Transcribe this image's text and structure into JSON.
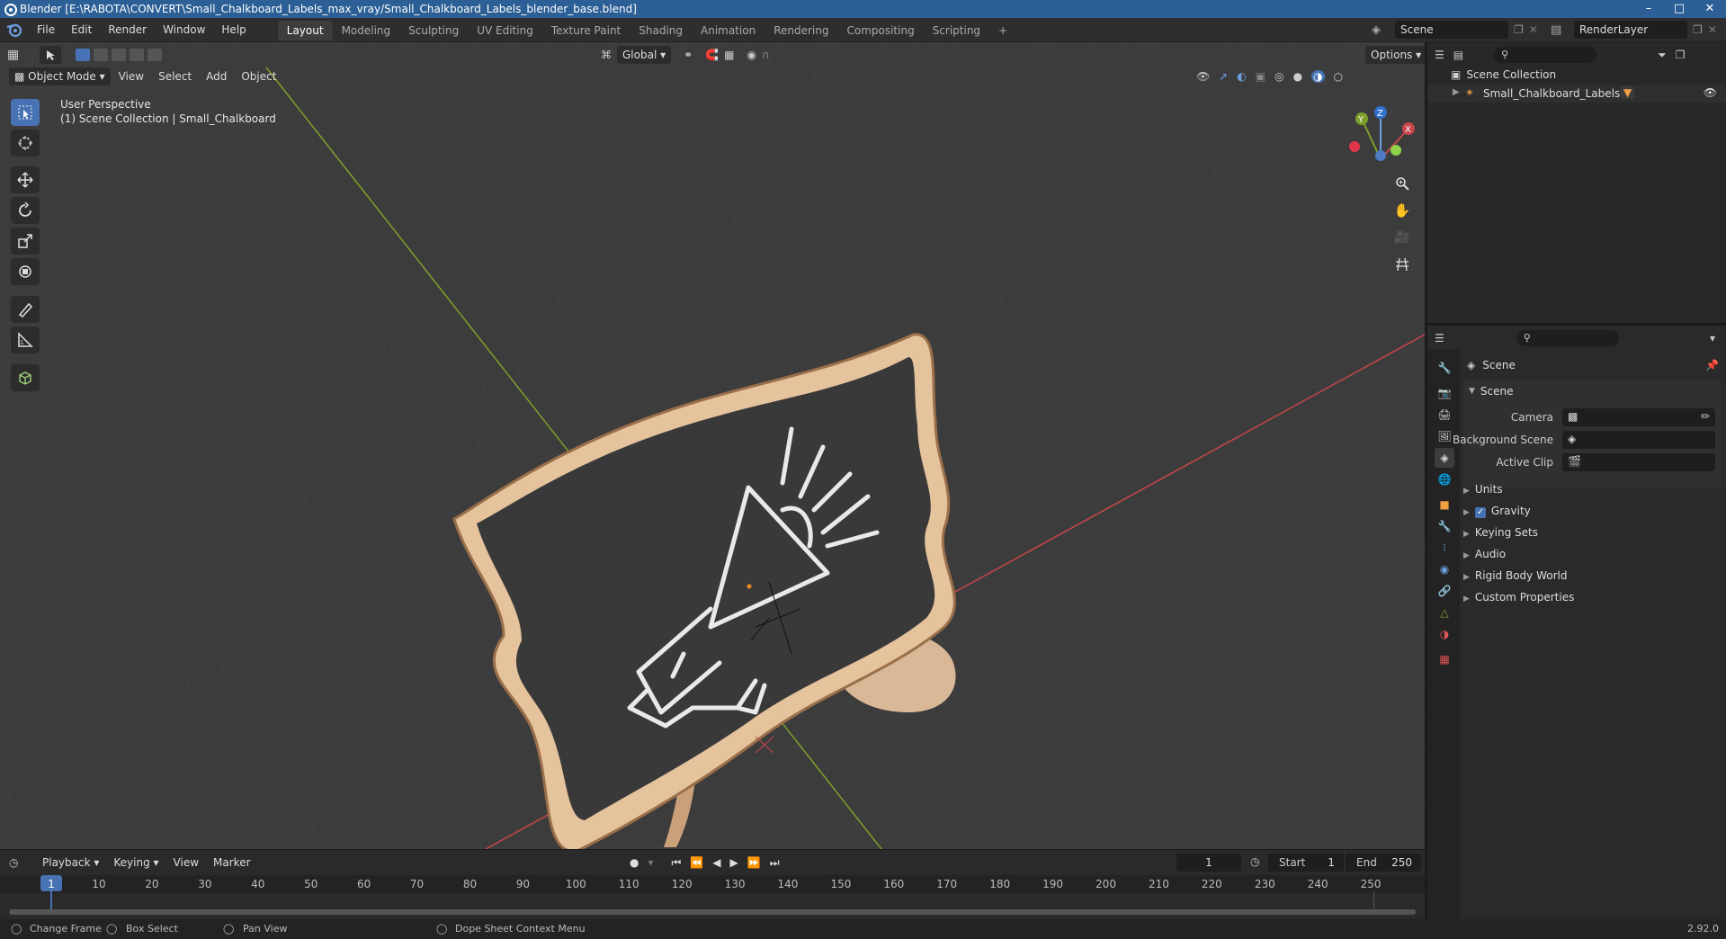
{
  "window": {
    "title": "Blender [E:\\RABOTA\\CONVERT\\Small_Chalkboard_Labels_max_vray/Small_Chalkboard_Labels_blender_base.blend]"
  },
  "menu": {
    "items": [
      "File",
      "Edit",
      "Render",
      "Window",
      "Help"
    ]
  },
  "workspaces": {
    "tabs": [
      "Layout",
      "Modeling",
      "Sculpting",
      "UV Editing",
      "Texture Paint",
      "Shading",
      "Animation",
      "Rendering",
      "Compositing",
      "Scripting"
    ],
    "active": "Layout",
    "add_label": "+"
  },
  "scene_selector": {
    "scene": "Scene",
    "render_layer": "RenderLayer"
  },
  "viewport_header": {
    "transform_orientation": "Global",
    "options_label": "Options",
    "mode": "Object Mode",
    "menus": [
      "View",
      "Select",
      "Add",
      "Object"
    ]
  },
  "viewport": {
    "perspective_label": "User Perspective",
    "collection_label": "(1) Scene Collection | Small_Chalkboard",
    "gizmo": {
      "x": "X",
      "y": "Y",
      "z": "Z"
    }
  },
  "timeline": {
    "menus": [
      "Playback",
      "Keying",
      "View",
      "Marker"
    ],
    "current_frame": "1",
    "start_label": "Start",
    "start_value": "1",
    "end_label": "End",
    "end_value": "250",
    "ruler": [
      "1",
      "10",
      "20",
      "30",
      "40",
      "50",
      "60",
      "70",
      "80",
      "90",
      "100",
      "110",
      "120",
      "130",
      "140",
      "150",
      "160",
      "170",
      "180",
      "190",
      "200",
      "210",
      "220",
      "230",
      "240",
      "250"
    ]
  },
  "statusbar": {
    "change_frame": "Change Frame",
    "box_select": "Box Select",
    "pan_view": "Pan View",
    "context_menu": "Dope Sheet Context Menu",
    "version": "2.92.0"
  },
  "outliner": {
    "root": "Scene Collection",
    "items": [
      {
        "label": "Small_Chalkboard_Labels"
      }
    ]
  },
  "properties": {
    "context": "Scene",
    "panel_title": "Scene",
    "fields": [
      {
        "label": "Camera"
      },
      {
        "label": "Background Scene"
      },
      {
        "label": "Active Clip"
      }
    ],
    "panels": [
      "Units",
      "Gravity",
      "Keying Sets",
      "Audio",
      "Rigid Body World",
      "Custom Properties"
    ],
    "gravity_checked": true
  },
  "colors": {
    "accent": "#4772b3",
    "title_bar": "#2b5f95",
    "viewport_bg": "#3c3c3c",
    "axis_x": "#c8464b",
    "axis_y": "#7da02b"
  }
}
